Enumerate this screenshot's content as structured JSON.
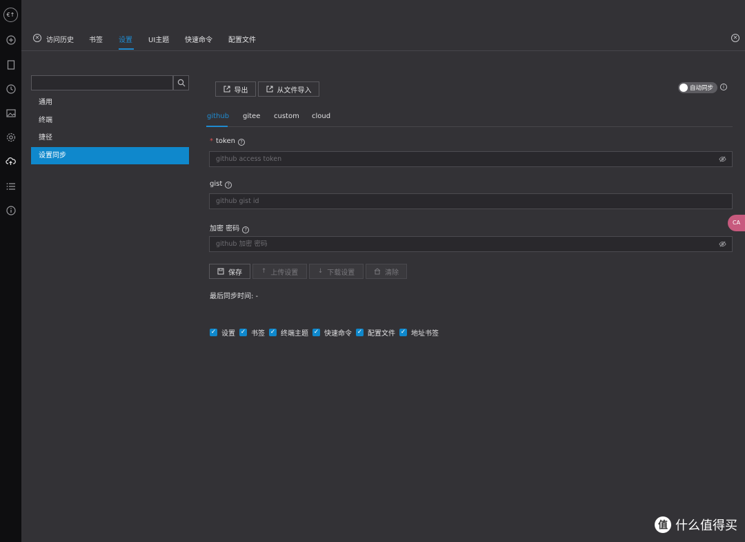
{
  "rail": {
    "logo_text": "€↑",
    "icons": [
      "plus-circle-icon",
      "bookmark-icon",
      "clock-icon",
      "image-icon",
      "gear-icon",
      "cloud-sync-icon",
      "list-icon",
      "info-icon"
    ]
  },
  "tabs": [
    "访问历史",
    "书签",
    "设置",
    "UI主题",
    "快速命令",
    "配置文件"
  ],
  "active_tab": "设置",
  "sidebar": {
    "search_value": "",
    "items": [
      "通用",
      "终端",
      "捷径",
      "设置同步"
    ],
    "active_item": "设置同步"
  },
  "toolbar": {
    "export_label": "导出",
    "import_label": "从文件导入",
    "auto_sync_label": "自动同步"
  },
  "provider_tabs": [
    "github",
    "gitee",
    "custom",
    "cloud"
  ],
  "active_provider": "github",
  "form": {
    "token_label": "token",
    "token_placeholder": "github access token",
    "gist_label": "gist",
    "gist_placeholder": "github gist id",
    "password_label": "加密 密码",
    "password_placeholder": "github 加密 密码"
  },
  "actions": {
    "save_label": "保存",
    "upload_label": "上传设置",
    "download_label": "下载设置",
    "clear_label": "清除"
  },
  "last_sync_text": "最后同步时间: -",
  "sync_items": [
    "设置",
    "书签",
    "终端主题",
    "快速命令",
    "配置文件",
    "地址书签"
  ],
  "float_button_text": "CA",
  "watermark": {
    "mark": "值",
    "text": "什么值得买"
  },
  "colors": {
    "accent": "#0f88cc",
    "background": "#333236",
    "rail": "#0e0e10"
  }
}
